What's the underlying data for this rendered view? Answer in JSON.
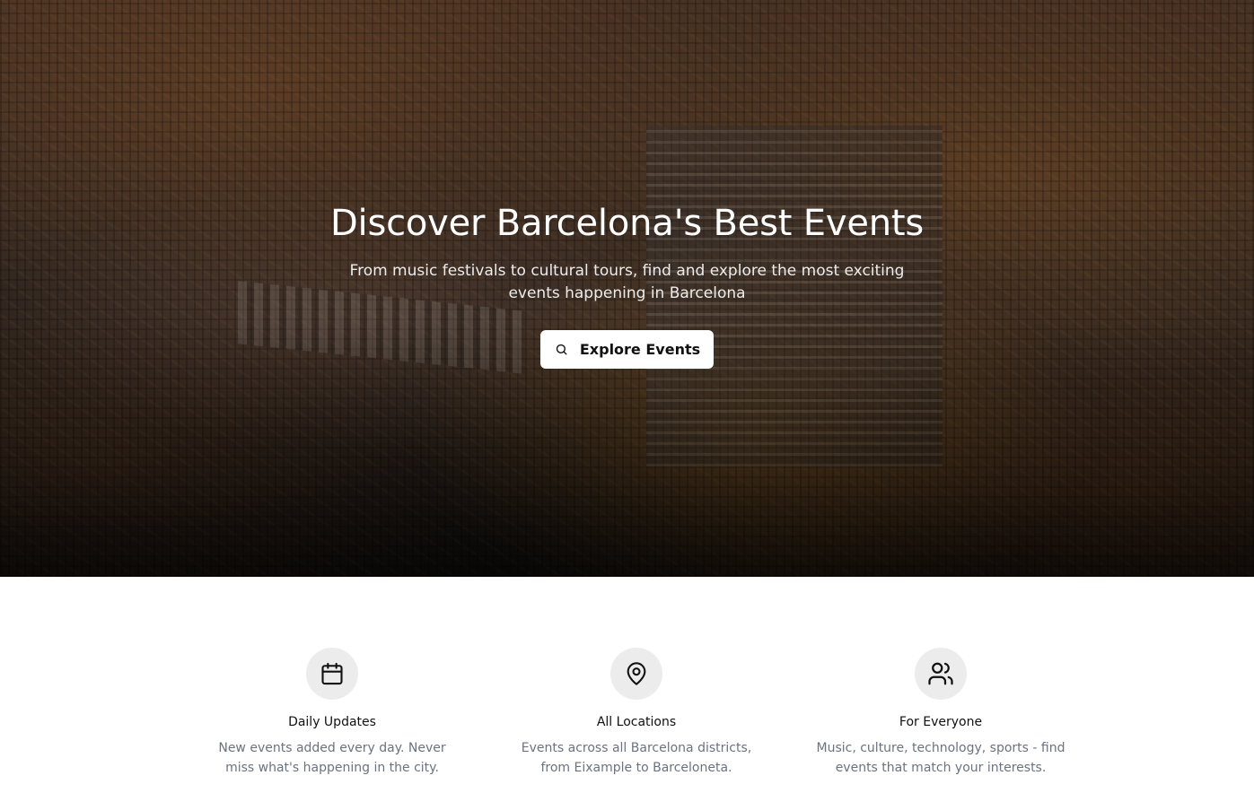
{
  "hero": {
    "title": "Discover Barcelona's Best Events",
    "subtitle": "From music festivals to cultural tours, find and explore the most exciting events happening in Barcelona",
    "cta_label": "Explore Events",
    "cta_icon": "search-icon"
  },
  "features": [
    {
      "icon": "calendar-icon",
      "title": "Daily Updates",
      "description": "New events added every day. Never miss what's happening in the city."
    },
    {
      "icon": "map-pin-icon",
      "title": "All Locations",
      "description": "Events across all Barcelona districts, from Eixample to Barceloneta."
    },
    {
      "icon": "users-icon",
      "title": "For Everyone",
      "description": "Music, culture, technology, sports - find events that match your interests."
    }
  ],
  "colors": {
    "icon_circle_bg": "#ececec",
    "description_text": "#6b7280",
    "button_bg": "#ffffff"
  }
}
